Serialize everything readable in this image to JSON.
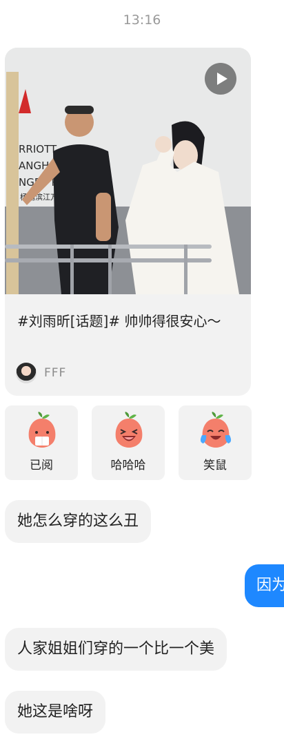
{
  "status_time": "13:16",
  "card": {
    "title": "#刘雨昕[话题]# 帅帅得很安心～",
    "author": "FFF",
    "sign_lines": [
      "RRIOTT",
      "ANGHAI",
      "NGPU RIV",
      "杨浦滨江万"
    ]
  },
  "stickers": [
    {
      "label": "已阅",
      "icon": "peach-reading-icon"
    },
    {
      "label": "哈哈哈",
      "icon": "peach-laughing-icon"
    },
    {
      "label": "笑鼠",
      "icon": "peach-crying-laugh-icon"
    }
  ],
  "messages": [
    {
      "side": "left",
      "text": "她怎么穿的这么丑"
    },
    {
      "side": "right",
      "text": "因为"
    },
    {
      "side": "left",
      "text": "人家姐姐们穿的一个比一个美"
    },
    {
      "side": "left",
      "text": "她这是啥呀"
    }
  ],
  "colors": {
    "accent": "#1e88ff",
    "bubble": "#f2f2f2",
    "peach": "#f47f6b"
  }
}
